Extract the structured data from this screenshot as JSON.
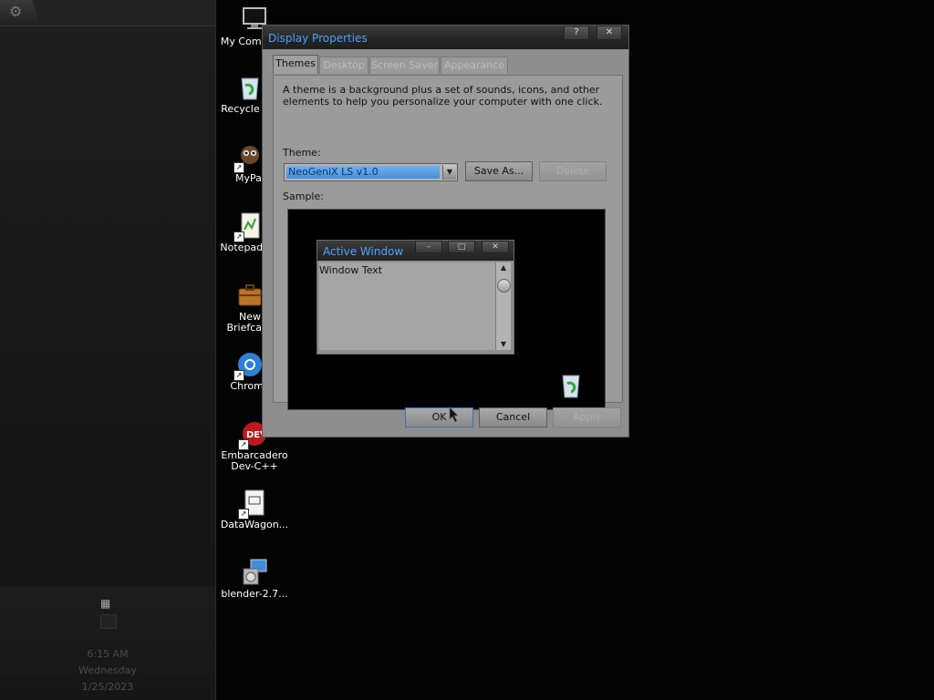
{
  "sidebar": {
    "clock": {
      "time": "6:15 AM",
      "day": "Wednesday",
      "date": "1/25/2023"
    }
  },
  "desktop_icons": [
    {
      "label": "My Computer",
      "icon": "monitor-icon"
    },
    {
      "label": "Recycle Bin",
      "icon": "recycle-bin-icon"
    },
    {
      "label": "MyPal",
      "icon": "mypal-icon"
    },
    {
      "label": "Notepad++",
      "icon": "notepad-icon"
    },
    {
      "label": "New Briefcase",
      "icon": "briefcase-icon"
    },
    {
      "label": "Chrome",
      "icon": "chrome-icon"
    },
    {
      "label": "Embarcadero Dev-C++",
      "icon": "devcpp-icon"
    },
    {
      "label": "DataWagon...",
      "icon": "document-icon"
    },
    {
      "label": "blender-2.7...",
      "icon": "installer-icon"
    }
  ],
  "dialog": {
    "title": "Display Properties",
    "help_btn": "?",
    "close_btn": "✕",
    "tabs": [
      {
        "label": "Themes",
        "active": true
      },
      {
        "label": "Desktop",
        "active": false
      },
      {
        "label": "Screen Saver",
        "active": false
      },
      {
        "label": "Appearance",
        "active": false
      }
    ],
    "description": "A theme is a background plus a set of sounds, icons, and other elements to help you personalize your computer with one click.",
    "theme_label": "Theme:",
    "theme_value": "NeoGeniX LS v1.0",
    "save_as": "Save As...",
    "delete": "Delete",
    "sample_label": "Sample:",
    "sample": {
      "window_title": "Active Window",
      "window_text": "Window Text",
      "min_btn": "–",
      "max_btn": "□",
      "close_btn": "✕"
    },
    "ok": "OK",
    "cancel": "Cancel",
    "apply": "Apply"
  },
  "colors": {
    "title_text": "#4ba3ff",
    "dialog_bg": "#8e8e8e",
    "desktop_bg": "#030303"
  }
}
